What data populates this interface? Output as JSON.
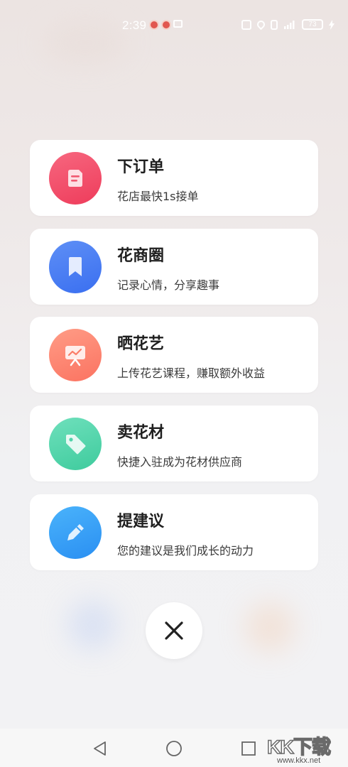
{
  "status_bar": {
    "time": "2:39",
    "battery": "73"
  },
  "menu": {
    "items": [
      {
        "title": "下订单",
        "subtitle": "花店最快1s接单",
        "icon": "order-note-icon",
        "color_start": "#f7677f",
        "color_end": "#ee3c5b"
      },
      {
        "title": "花商圈",
        "subtitle": "记录心情，分享趣事",
        "icon": "bookmark-icon",
        "color_start": "#5e8ff6",
        "color_end": "#3a6ff0"
      },
      {
        "title": "晒花艺",
        "subtitle": "上传花艺课程，赚取额外收益",
        "icon": "presentation-board-icon",
        "color_start": "#ff9c86",
        "color_end": "#fb7361"
      },
      {
        "title": "卖花材",
        "subtitle": "快捷入驻成为花材供应商",
        "icon": "price-tag-icon",
        "color_start": "#6fe0bc",
        "color_end": "#3ecb9d"
      },
      {
        "title": "提建议",
        "subtitle": "您的建议是我们成长的动力",
        "icon": "pen-edit-icon",
        "color_start": "#4ab3fb",
        "color_end": "#2a8ff2"
      }
    ]
  },
  "close_icon": "close-x-icon",
  "watermark": {
    "logo": "KK下载",
    "url": "www.kkx.net"
  }
}
